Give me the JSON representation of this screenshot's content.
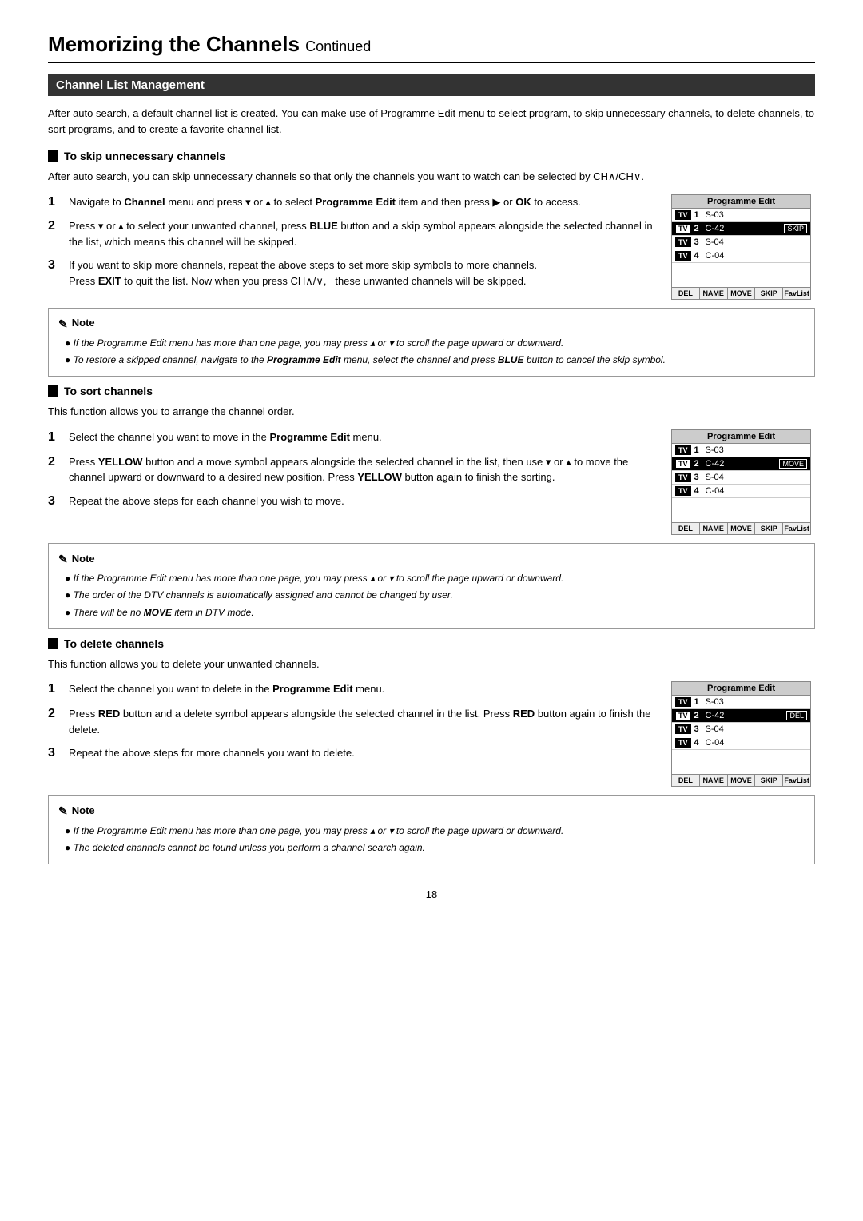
{
  "page": {
    "title": "Memorizing the Channels",
    "continued": "Continued",
    "page_number": "18"
  },
  "channel_list_management": {
    "header": "Channel List Management",
    "intro": "After auto search, a default channel list is created. You can make use of Programme Edit menu to select program, to skip unnecessary channels, to delete channels, to sort programs, and to create a favorite channel list."
  },
  "skip_section": {
    "title": "To skip unnecessary channels",
    "intro": "After auto search, you can skip unnecessary channels so that only the channels you want to watch can be selected by CH∧/CH∨.",
    "steps": [
      {
        "num": "1",
        "text": "Navigate to Channel menu and press ▾ or ▴ to select Programme Edit item and then press ▶ or OK to access."
      },
      {
        "num": "2",
        "text": "Press ▾ or ▴ to select your unwanted channel, press BLUE button and a skip symbol appears alongside the selected channel in the list, which means this channel will be skipped."
      },
      {
        "num": "3",
        "text": "If you want to skip more channels, repeat the above steps to set more skip symbols to more channels. Press EXIT to quit the list. Now when you press CH∧/∨,   these unwanted channels will be skipped."
      }
    ],
    "panel": {
      "title": "Programme Edit",
      "rows": [
        {
          "tv": "TV",
          "num": "1",
          "name": "S-03",
          "badge": "",
          "selected": false
        },
        {
          "tv": "TV",
          "num": "2",
          "name": "C-42",
          "badge": "SKIP",
          "selected": true
        },
        {
          "tv": "TV",
          "num": "3",
          "name": "S-04",
          "badge": "",
          "selected": false
        },
        {
          "tv": "TV",
          "num": "4",
          "name": "C-04",
          "badge": "",
          "selected": false
        }
      ],
      "footer": [
        "DEL",
        "NAME",
        "MOVE",
        "SKIP",
        "FavList"
      ]
    },
    "notes": [
      "If the Programme Edit menu has more than one page, you may press ▴ or ▾  to scroll the page upward or downward.",
      "To restore a skipped channel, navigate to the Programme Edit menu, select the channel and press BLUE button to cancel the skip symbol."
    ]
  },
  "sort_section": {
    "title": "To sort channels",
    "intro": "This function allows you to arrange the channel order.",
    "steps": [
      {
        "num": "1",
        "text": "Select the channel you want to move in the Programme Edit menu."
      },
      {
        "num": "2",
        "text": "Press YELLOW button and a move symbol appears alongside the selected channel in the list, then use ▾ or ▴ to move the channel upward or downward to a desired new position. Press YELLOW button again to finish the sorting."
      },
      {
        "num": "3",
        "text": "Repeat the above steps for each channel you wish to move."
      }
    ],
    "panel": {
      "title": "Programme Edit",
      "rows": [
        {
          "tv": "TV",
          "num": "1",
          "name": "S-03",
          "badge": "",
          "selected": false
        },
        {
          "tv": "TV",
          "num": "2",
          "name": "C-42",
          "badge": "MOVE",
          "selected": true
        },
        {
          "tv": "TV",
          "num": "3",
          "name": "S-04",
          "badge": "",
          "selected": false
        },
        {
          "tv": "TV",
          "num": "4",
          "name": "C-04",
          "badge": "",
          "selected": false
        }
      ],
      "footer": [
        "DEL",
        "NAME",
        "MOVE",
        "SKIP",
        "FavList"
      ]
    },
    "notes": [
      "If the Programme Edit menu has more than one page, you may press ▴ or ▾  to scroll the page upward or downward.",
      "The order of the DTV channels is automatically assigned and cannot be changed by user.",
      "There will be no MOVE item in DTV mode."
    ]
  },
  "delete_section": {
    "title": "To delete channels",
    "intro": "This function allows you to delete your unwanted channels.",
    "steps": [
      {
        "num": "1",
        "text": "Select the channel you want to delete in the Programme Edit menu."
      },
      {
        "num": "2",
        "text": "Press RED button and a delete symbol appears alongside the selected channel in the list. Press RED button again to finish the delete."
      },
      {
        "num": "3",
        "text": "Repeat the above steps for more channels you want to delete."
      }
    ],
    "panel": {
      "title": "Programme Edit",
      "rows": [
        {
          "tv": "TV",
          "num": "1",
          "name": "S-03",
          "badge": "",
          "selected": false
        },
        {
          "tv": "TV",
          "num": "2",
          "name": "C-42",
          "badge": "DEL",
          "selected": true
        },
        {
          "tv": "TV",
          "num": "3",
          "name": "S-04",
          "badge": "",
          "selected": false
        },
        {
          "tv": "TV",
          "num": "4",
          "name": "C-04",
          "badge": "",
          "selected": false
        }
      ],
      "footer": [
        "DEL",
        "NAME",
        "MOVE",
        "SKIP",
        "FavList"
      ]
    },
    "notes": [
      "If the Programme Edit menu has more than one page, you may press ▴ or ▾  to scroll the page upward or downward.",
      "The deleted channels cannot be found unless you perform a channel search again."
    ]
  }
}
